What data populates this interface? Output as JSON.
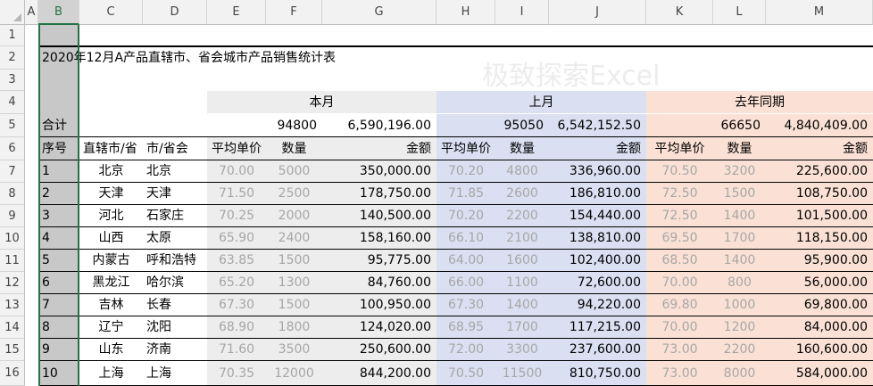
{
  "columns": [
    "A",
    "B",
    "C",
    "D",
    "E",
    "F",
    "G",
    "H",
    "I",
    "J",
    "K",
    "L",
    "M"
  ],
  "rows": [
    "1",
    "2",
    "3",
    "4",
    "5",
    "6",
    "7",
    "8",
    "9",
    "10",
    "11",
    "12",
    "13",
    "14",
    "15",
    "16"
  ],
  "selected_column": "B",
  "title": "2020年12月A产品直辖市、省会城市产品销售统计表",
  "watermark": "极致探索Excel",
  "groups": {
    "current": "本月",
    "prev": "上月",
    "lastyear": "去年同期"
  },
  "totals": {
    "label": "合计",
    "current_qty": "94800",
    "current_amt": "6,590,196.00",
    "prev_qty": "95050",
    "prev_amt": "6,542,152.50",
    "ly_qty": "66650",
    "ly_amt": "4,840,409.00"
  },
  "headers": {
    "seq": "序号",
    "province": "直辖市/省",
    "city": "市/省会",
    "avg_price": "平均单价",
    "qty": "数量",
    "amount": "金额"
  },
  "data_rows": [
    {
      "seq": "1",
      "province": "北京",
      "city": "北京",
      "p1": "70.00",
      "q1": "5000",
      "a1": "350,000.00",
      "p2": "70.20",
      "q2": "4800",
      "a2": "336,960.00",
      "p3": "70.50",
      "q3": "3200",
      "a3": "225,600.00"
    },
    {
      "seq": "2",
      "province": "天津",
      "city": "天津",
      "p1": "71.50",
      "q1": "2500",
      "a1": "178,750.00",
      "p2": "71.85",
      "q2": "2600",
      "a2": "186,810.00",
      "p3": "72.50",
      "q3": "1500",
      "a3": "108,750.00"
    },
    {
      "seq": "3",
      "province": "河北",
      "city": "石家庄",
      "p1": "70.25",
      "q1": "2000",
      "a1": "140,500.00",
      "p2": "70.20",
      "q2": "2200",
      "a2": "154,440.00",
      "p3": "72.50",
      "q3": "1400",
      "a3": "101,500.00"
    },
    {
      "seq": "4",
      "province": "山西",
      "city": "太原",
      "p1": "65.90",
      "q1": "2400",
      "a1": "158,160.00",
      "p2": "66.10",
      "q2": "2100",
      "a2": "138,810.00",
      "p3": "69.50",
      "q3": "1700",
      "a3": "118,150.00"
    },
    {
      "seq": "5",
      "province": "内蒙古",
      "city": "呼和浩特",
      "p1": "63.85",
      "q1": "1500",
      "a1": "95,775.00",
      "p2": "64.00",
      "q2": "1600",
      "a2": "102,400.00",
      "p3": "68.50",
      "q3": "1400",
      "a3": "95,900.00"
    },
    {
      "seq": "6",
      "province": "黑龙江",
      "city": "哈尔滨",
      "p1": "65.20",
      "q1": "1300",
      "a1": "84,760.00",
      "p2": "66.00",
      "q2": "1100",
      "a2": "72,600.00",
      "p3": "70.00",
      "q3": "800",
      "a3": "56,000.00"
    },
    {
      "seq": "7",
      "province": "吉林",
      "city": "长春",
      "p1": "67.30",
      "q1": "1500",
      "a1": "100,950.00",
      "p2": "67.30",
      "q2": "1400",
      "a2": "94,220.00",
      "p3": "69.80",
      "q3": "1000",
      "a3": "69,800.00"
    },
    {
      "seq": "8",
      "province": "辽宁",
      "city": "沈阳",
      "p1": "68.90",
      "q1": "1800",
      "a1": "124,020.00",
      "p2": "68.95",
      "q2": "1700",
      "a2": "117,215.00",
      "p3": "70.00",
      "q3": "1200",
      "a3": "84,000.00"
    },
    {
      "seq": "9",
      "province": "山东",
      "city": "济南",
      "p1": "71.60",
      "q1": "3500",
      "a1": "250,600.00",
      "p2": "72.00",
      "q2": "3300",
      "a2": "237,600.00",
      "p3": "73.00",
      "q3": "2200",
      "a3": "160,600.00"
    },
    {
      "seq": "10",
      "province": "上海",
      "city": "上海",
      "p1": "70.35",
      "q1": "12000",
      "a1": "844,200.00",
      "p2": "70.50",
      "q2": "11500",
      "a2": "810,750.00",
      "p3": "73.00",
      "q3": "8000",
      "a3": "584,000.00"
    }
  ],
  "colors": {
    "header_bg": "#f2f2f2",
    "current_band": "#ededed",
    "prev_band": "#dae0f2",
    "lastyear_band": "#fbe1d5",
    "selected_col": "#c8c8c8",
    "accent": "#217346"
  }
}
